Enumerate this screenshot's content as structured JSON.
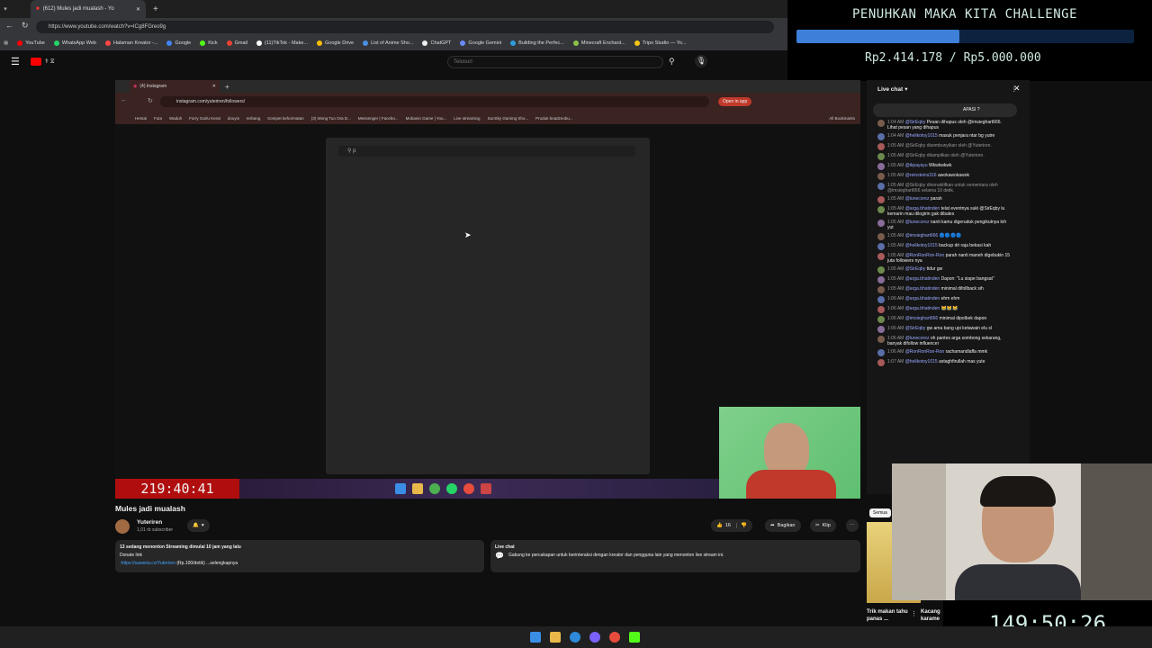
{
  "browser": {
    "tab_title": "(612) Mules jadi mualash - Yo",
    "url": "https://www.youtube.com/watch?v=ICg8FGreo9g",
    "bookmarks": [
      "YouTube",
      "WhatsApp Web",
      "Halaman Kreator -...",
      "Google",
      "Kick",
      "Gmail",
      "(11)TikTok - Make...",
      "Google Drive",
      "List of Anime Sho...",
      "ChatGPT",
      "Google Gemini",
      "Building the Perfec...",
      "Minecraft Enchant...",
      "Tripo Studio — Yo..."
    ]
  },
  "youtube": {
    "search_placeholder": "Telusuri"
  },
  "challenge": {
    "title": "PENUHKAN MAKA KITA CHALLENGE",
    "progress": 0.4828,
    "amount": "Rp2.414.178 / Rp5.000.000"
  },
  "inner_browser": {
    "tab_title": "(4) Instagram",
    "url": "instagram.com/yuteriren/followers/",
    "open_app": "Open in app",
    "bookmarks": [
      "Hentai",
      "Futa",
      "Waduh",
      "Furry Garlu Kerat",
      "douyin",
      "terbang",
      "trompet kehormatan",
      "(3) Wong Tuo Ora D...",
      "Messenger | Facebo...",
      "Mobanin Game | You...",
      "Live streaming",
      "SunSky Gaming Sho...",
      "Produk bnadzeobu..."
    ],
    "all_bookmarks": "All Bookmarks",
    "modal_search": "p"
  },
  "timers": {
    "left": "219:40:41",
    "right": "149:50:26"
  },
  "video": {
    "title": "Mules jadi mualash",
    "channel": "Yuteriren",
    "subscribers": "1,01 rb subscriber",
    "likes": "16",
    "share_label": "Bagikan",
    "clip_label": "Klip",
    "description_line1": "13 sedang menonton  Streaming dimulai 10 jam yang lalu",
    "description_line2": "Donate link",
    "description_link": "-https://saweria.co/Yuteriren",
    "description_more": "(Rp.100/detik) ...selengkapnya",
    "livechat_title": "Live chat",
    "livechat_text": "Gabung ke percakapan untuk berinteraksi dengan kreator dan pengguna lain yang menonton live stream ini."
  },
  "chat": {
    "header": "Live chat",
    "pinned": "APASI ?",
    "filter": "Semua",
    "messages": [
      {
        "time": "1:04 AM",
        "user": "@SirEqby",
        "text": "Pesan dihapus oleh @imsieghart666. Lihat pesan yang dihapus"
      },
      {
        "time": "1:04 AM",
        "user": "@helikotoy1015",
        "text": "masuk penjara ntar bg yutre"
      },
      {
        "time": "1:05 AM",
        "user": "",
        "text": "@SirEqby disembunyikan oleh @Yuteriren."
      },
      {
        "time": "1:05 AM",
        "user": "",
        "text": "@SirEqby ditampilkan oleh @Yuteriren."
      },
      {
        "time": "1:05 AM",
        "user": "@ikpayayu",
        "text": "Wkwkwkwk"
      },
      {
        "time": "1:05 AM",
        "user": "@reinsteins316",
        "text": "awokawokawok"
      },
      {
        "time": "1:05 AM",
        "user": "",
        "text": "@SirEqby dinonaktifkan untuk sementara oleh @imsieghart666 selama 10 detik."
      },
      {
        "time": "1:05 AM",
        "user": "@lunecorez",
        "text": "parah"
      },
      {
        "time": "1:05 AM",
        "user": "@arga.bhatinden",
        "text": "telat eventnya suki @SirEqby lu kemarin mau dilogirin gak dibales"
      },
      {
        "time": "1:05 AM",
        "user": "@lunecorez",
        "text": "nanti kamu digeruduk pengikutnya loh yut"
      },
      {
        "time": "1:05 AM",
        "user": "@imsieghart666",
        "text": "🔵🔵🔵🔵"
      },
      {
        "time": "1:05 AM",
        "user": "@helikotoy1015",
        "text": "backup dri raja bekasi kah"
      },
      {
        "time": "1:05 AM",
        "user": "@RonRonRon-Ron",
        "text": "parah nanti maneh digebukin 15 juta followers nya"
      },
      {
        "time": "1:05 AM",
        "user": "@SirEqby",
        "text": "tidur gw"
      },
      {
        "time": "1:05 AM",
        "user": "@arga.bhatinden",
        "text": "Dapon: \"Lu siape bangsat\""
      },
      {
        "time": "1:05 AM",
        "user": "@arga.bhatinden",
        "text": "minimal difollback sih"
      },
      {
        "time": "1:06 AM",
        "user": "@arga.bhatinden",
        "text": "ehm ehm"
      },
      {
        "time": "1:06 AM",
        "user": "@arga.bhatinden",
        "text": "😹😹😹"
      },
      {
        "time": "1:06 AM",
        "user": "@imsieghart666",
        "text": "minimal dipolbek dapon"
      },
      {
        "time": "1:06 AM",
        "user": "@SirEqby",
        "text": "gw ama bang upi ketawain elu sl"
      },
      {
        "time": "1:06 AM",
        "user": "@lunecorez",
        "text": "oh pantes arga sombong sekarang, banyak difollow influencer"
      },
      {
        "time": "1:06 AM",
        "user": "@RonRonRon-Ron",
        "text": "rachamandlaffa mmk"
      },
      {
        "time": "1:07 AM",
        "user": "@helikotoy1015",
        "text": "astaghfirullah mas yute"
      }
    ]
  },
  "recommend": {
    "item1": "Trik makan tahu panas ...",
    "item2": "Kacang karame"
  }
}
